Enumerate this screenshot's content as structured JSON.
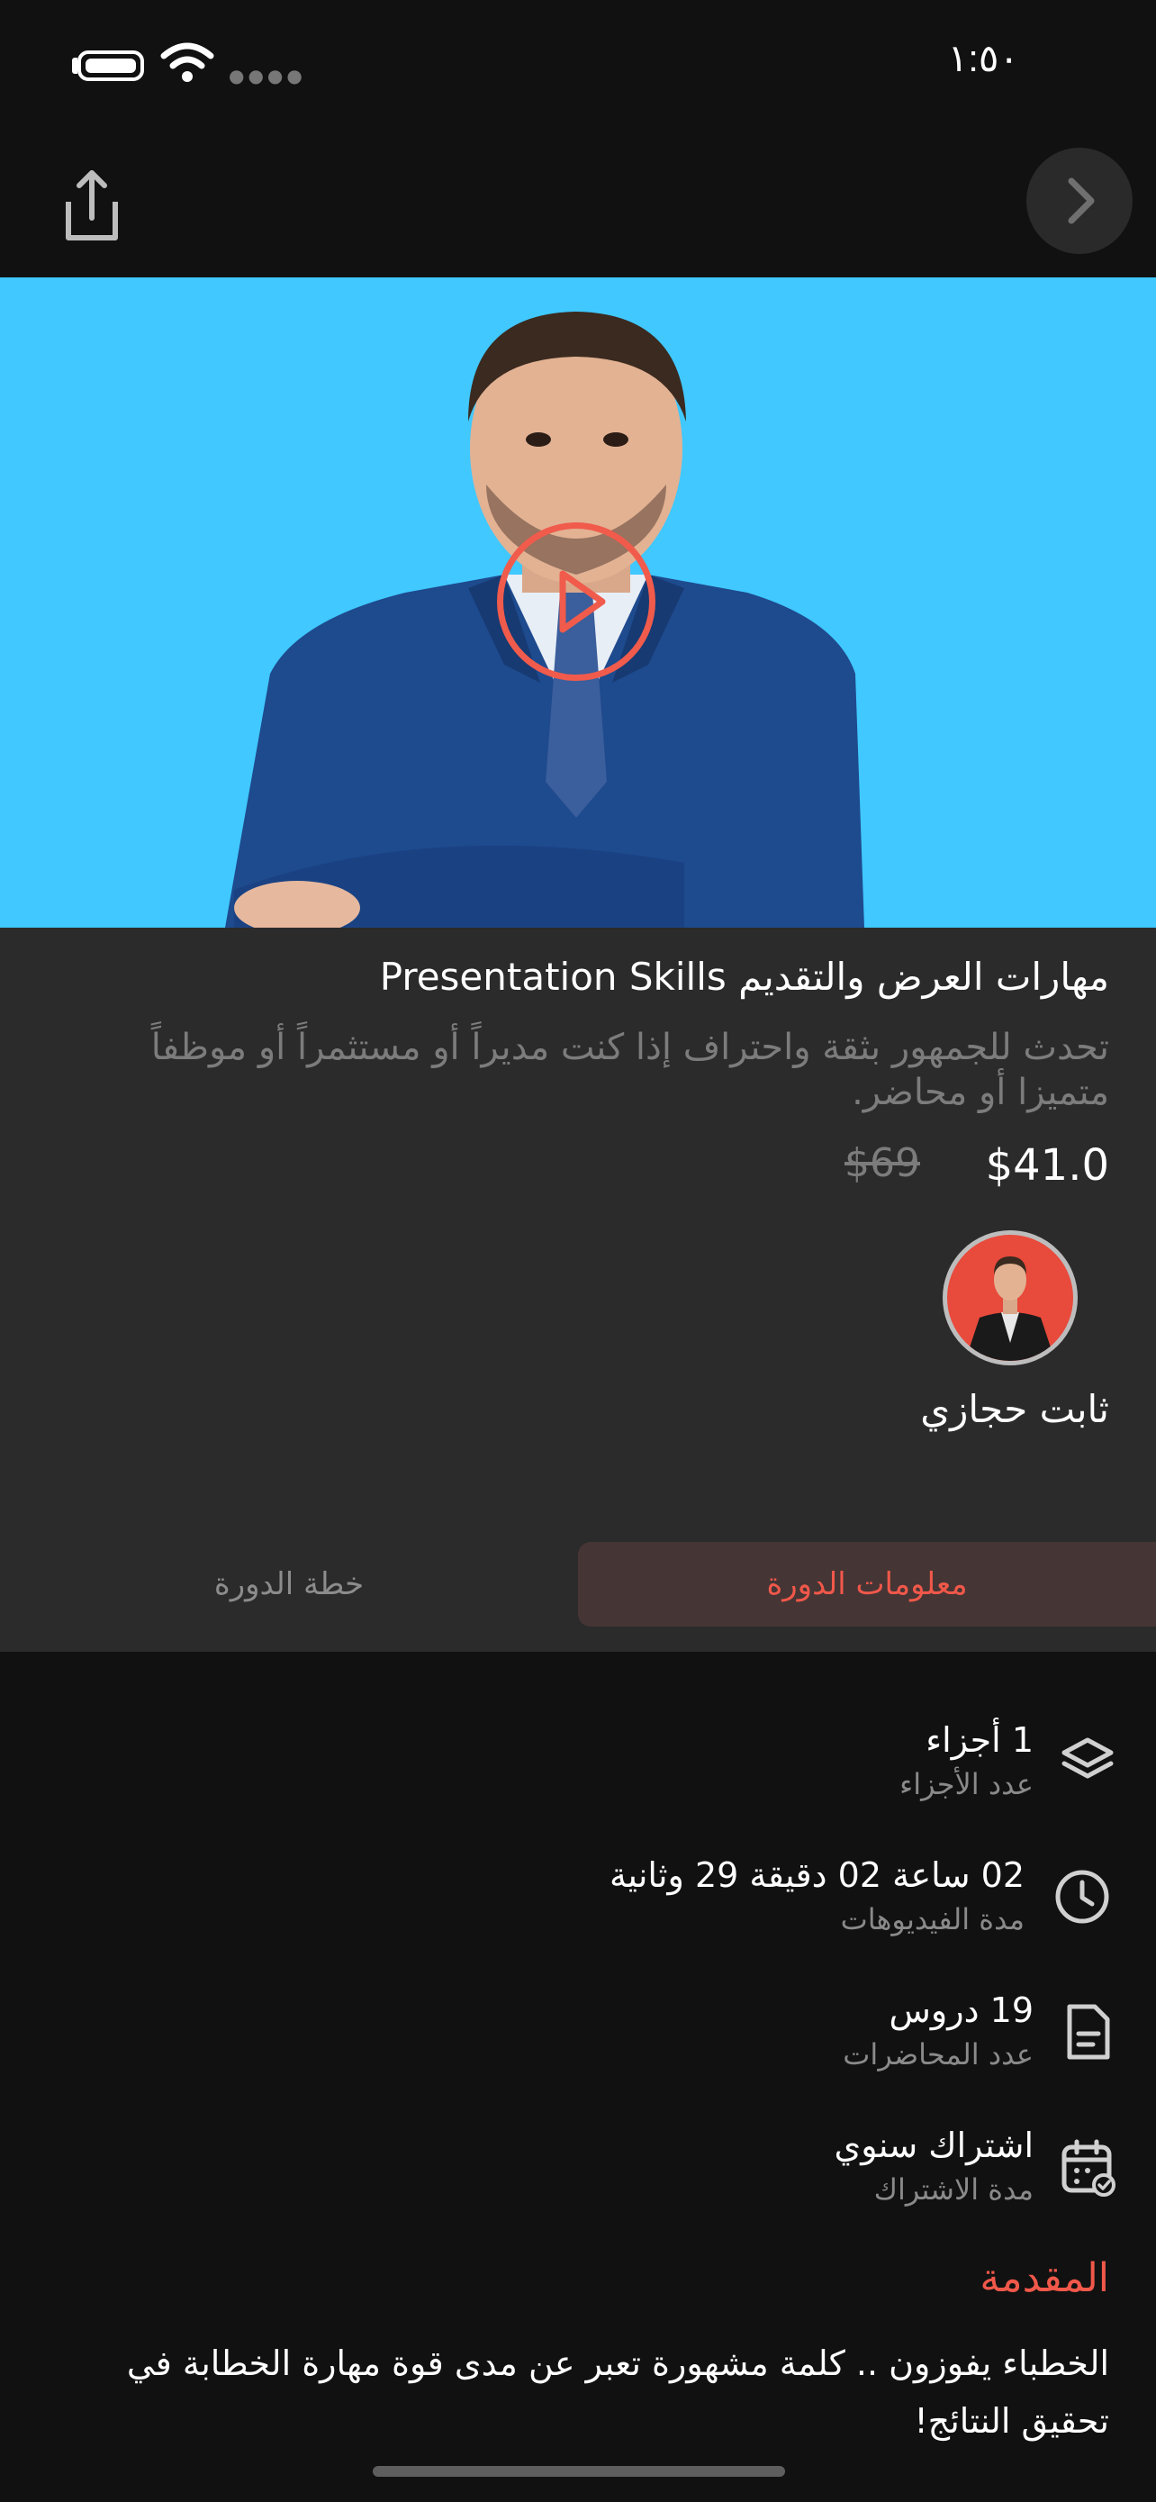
{
  "status_bar": {
    "time": "١:٥٠"
  },
  "course": {
    "title": "مهارات العرض والتقديم Presentation Skills",
    "description": "تحدث للجمهور بثقة واحتراف إذا كنت مديراً أو مستثمراً أو موظفاً متميزا أو محاضر.",
    "price": "$41.0",
    "old_price": "$69",
    "instructor": "ثابت حجازي"
  },
  "tabs": {
    "info": "معلومات الدورة",
    "plan": "خطة الدورة"
  },
  "details": [
    {
      "icon": "layers-icon",
      "value": "1 أجزاء",
      "label": "عدد الأجزاء"
    },
    {
      "icon": "clock-icon",
      "value": "02 ساعة 02 دقيقة 29 وثانية",
      "label": "مدة الفيديوهات"
    },
    {
      "icon": "document-icon",
      "value": "19 دروس",
      "label": "عدد المحاضرات"
    },
    {
      "icon": "calendar-icon",
      "value": "اشتراك سنوي",
      "label": "مدة الاشتراك"
    }
  ],
  "intro": {
    "title": "المقدمة",
    "text": "الخطباء يفوزون .. كلمة مشهورة تعبر عن مدى قوة مهارة الخطابة في تحقيق النتائج!"
  },
  "colors": {
    "accent": "#f05b4c",
    "hero_bg": "#40c8ff",
    "card_bg": "#2b2b2b",
    "page_bg": "#111111"
  }
}
